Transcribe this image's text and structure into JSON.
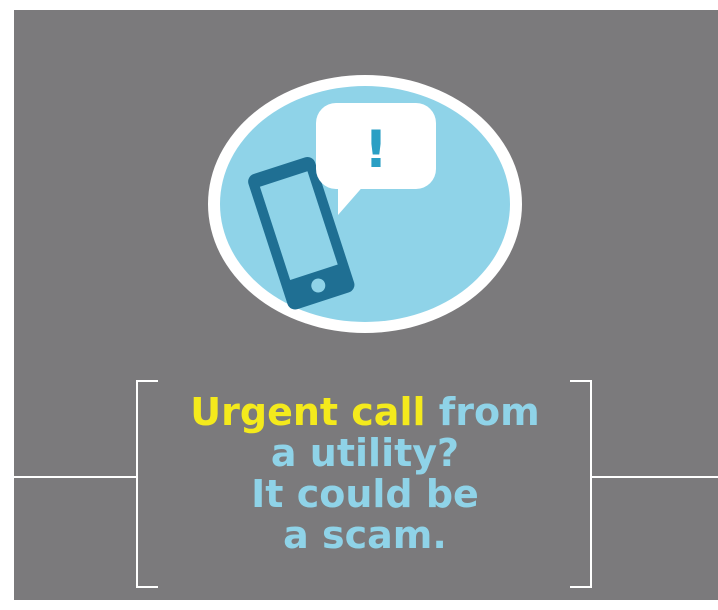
{
  "headline": {
    "highlight": "Urgent call",
    "rest_line1": " from",
    "line2": "a utility?",
    "line3": "It could be",
    "line4": "a scam."
  },
  "icon": {
    "name": "phone-alert-icon",
    "bubble_mark": "!"
  },
  "colors": {
    "background": "#7b7a7c",
    "circle_fill": "#8fd3e8",
    "phone": "#1f6f93",
    "highlight_text": "#f4ea1c",
    "body_text": "#8fd3e8"
  }
}
